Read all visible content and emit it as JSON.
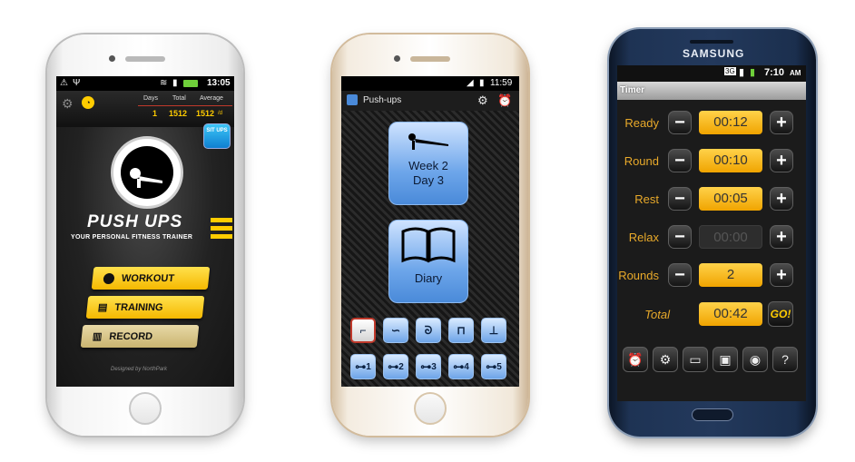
{
  "screen_a": {
    "status_time": "13:05",
    "stats_headers": [
      "Days",
      "Total",
      "Average"
    ],
    "stats_values": [
      "1",
      "1512",
      "1512"
    ],
    "stats_unit": "/d",
    "badge_text": "SIT UPS",
    "title": "PUSH UPS",
    "subtitle": "YOUR PERSONAL FITNESS TRAINER",
    "menu": [
      "WORKOUT",
      "TRAINING",
      "RECORD"
    ],
    "credit": "Designed by NorthPark",
    "accent": "#ffcc00"
  },
  "screen_b": {
    "status_time": "11:59",
    "app_title": "Push-ups",
    "workout_line1": "Week 2",
    "workout_line2": "Day 3",
    "diary_label": "Diary",
    "level_labels": [
      "1",
      "2",
      "3",
      "4",
      "5"
    ],
    "accent": "#6ea6ea"
  },
  "screen_c": {
    "brand": "SAMSUNG",
    "status_time": "7:10",
    "status_ampm": "AM",
    "title": "Timer",
    "rows": [
      {
        "label": "Ready",
        "value": "00:12"
      },
      {
        "label": "Round",
        "value": "00:10"
      },
      {
        "label": "Rest",
        "value": "00:05"
      },
      {
        "label": "Relax",
        "value": "00:00"
      },
      {
        "label": "Rounds",
        "value": "2"
      }
    ],
    "total_label": "Total",
    "total_value": "00:42",
    "go_label": "GO!",
    "accent": "#f0a400"
  }
}
